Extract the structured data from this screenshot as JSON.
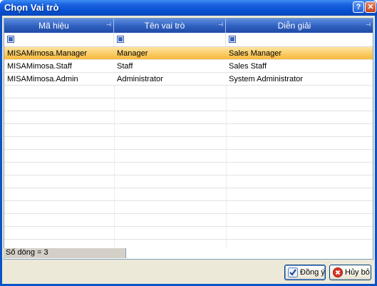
{
  "window": {
    "title": "Chọn Vai trò"
  },
  "grid": {
    "columns": [
      {
        "label": "Mã hiệu"
      },
      {
        "label": "Tên vai trò"
      },
      {
        "label": "Diễn giải"
      }
    ],
    "rows": [
      {
        "cells": [
          "MISAMimosa.Manager",
          "Manager",
          "Sales Manager"
        ],
        "selected": true
      },
      {
        "cells": [
          "MISAMimosa.Staff",
          "Staff",
          "Sales Staff"
        ],
        "selected": false
      },
      {
        "cells": [
          "MISAMimosa.Admin",
          "Administrator",
          "System Administrator"
        ],
        "selected": false
      }
    ],
    "status": "Số dòng = 3"
  },
  "buttons": {
    "ok": "Đồng ý",
    "cancel": "Hủy bỏ"
  },
  "colors": {
    "titlebar": "#0750d2",
    "header": "#2f5fbe",
    "selected_row": "#f7b83a"
  },
  "icons": {
    "ok": "check-icon",
    "cancel": "cancel-circle-icon",
    "pin": "pin-icon",
    "filter": "filter-icon"
  }
}
